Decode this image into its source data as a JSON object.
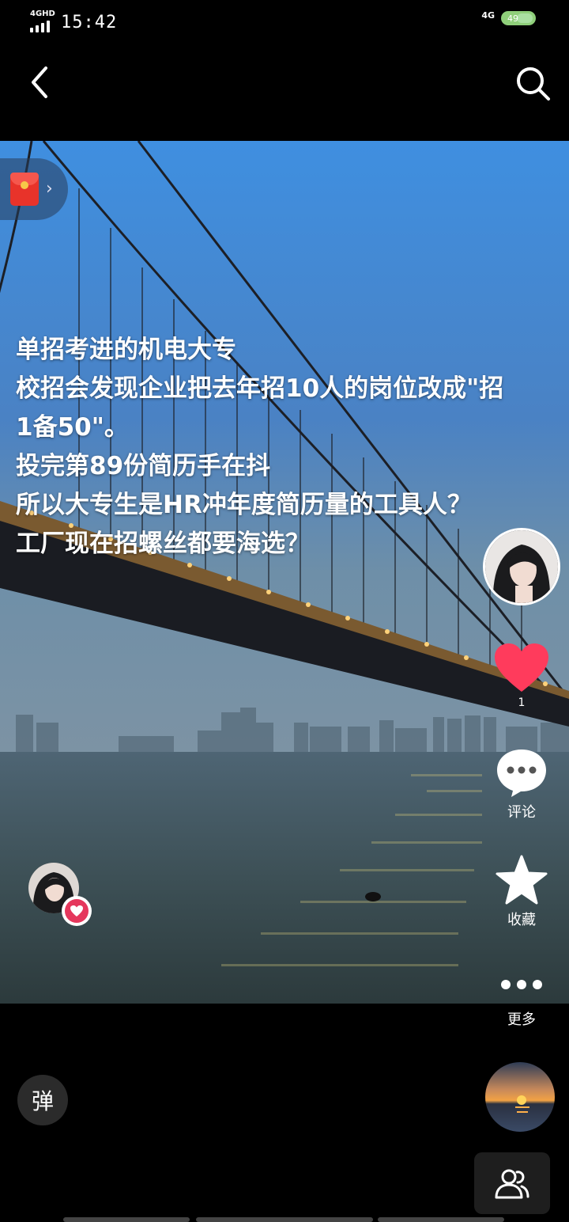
{
  "status_bar": {
    "network_label": "4GHD",
    "time": "15:42",
    "network_type": "4G",
    "battery": "49"
  },
  "top_nav": {
    "back_icon": "chevron-left-icon",
    "search_icon": "search-icon"
  },
  "caption": {
    "lines": [
      "单招考进的机电大专",
      "校招会发现企业把去年招10人的岗位改成\"招",
      "1备50\"。",
      "投完第89份简历手在抖",
      "所以大专生是HR冲年度简历量的工具人？",
      "工厂现在招螺丝都要海选？"
    ]
  },
  "actions": {
    "like_count": "1",
    "comment_label": "评论",
    "collect_label": "收藏",
    "more_label": "更多"
  },
  "bottom": {
    "danmaku_label": "弹"
  },
  "colors": {
    "like_red": "#ff3b5c",
    "redpacket_red": "#e8332a",
    "background": "#000000"
  }
}
